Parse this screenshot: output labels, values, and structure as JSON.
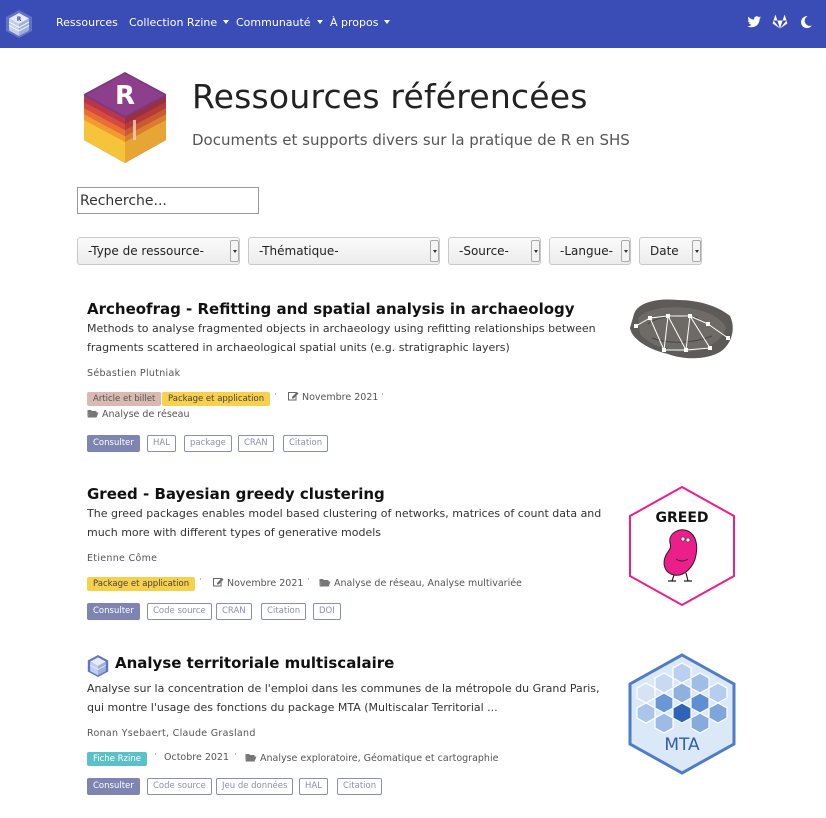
{
  "nav": {
    "items": [
      {
        "label": "Ressources",
        "dropdown": false
      },
      {
        "label": "Collection Rzine",
        "dropdown": true
      },
      {
        "label": "Communauté",
        "dropdown": true
      },
      {
        "label": "À propos",
        "dropdown": true
      }
    ],
    "icons": [
      "twitter-icon",
      "gitlab-icon",
      "dark-mode-moon-icon"
    ],
    "bar_color": "#3a4cb5"
  },
  "header": {
    "title": "Ressources référencées",
    "subtitle": "Documents et supports divers sur la pratique de R en SHS",
    "logo_letter": "R"
  },
  "search": {
    "placeholder": "Recherche...",
    "value": ""
  },
  "filters": [
    {
      "label": "-Type de ressource-"
    },
    {
      "label": "-Thématique-"
    },
    {
      "label": "-Source-"
    },
    {
      "label": "-Langue-"
    },
    {
      "label": "Date"
    }
  ],
  "entries": [
    {
      "title": "Archeofrag - Refitting and spatial analysis in archaeology",
      "description": "Methods to analyse fragmented objects in archaeology using refitting relationships between fragments scattered in archaeological spatial units (e.g. stratigraphic layers)",
      "authors": "Sébastien Plutniak",
      "badges": [
        "Article et billet",
        "Package et application"
      ],
      "date": "Novembre 2021",
      "topics": "Analyse de réseau",
      "buttons": [
        "Consulter",
        "HAL",
        "package",
        "CRAN",
        "Citation"
      ]
    },
    {
      "title": "Greed - Bayesian greedy clustering",
      "description": "The greed packages enables model based clustering of networks, matrices of count data and much more with different types of generative models",
      "authors": "Etienne Côme",
      "badges": [
        "Package et application"
      ],
      "date": "Novembre 2021",
      "topics": "Analyse de réseau, Analyse multivariée",
      "buttons": [
        "Consulter",
        "Code source",
        "CRAN",
        "Citation",
        "DOI"
      ],
      "logo_text": "GREED"
    },
    {
      "title": "Analyse territoriale multiscalaire",
      "description": "Analyse sur la concentration de l'emploi dans les communes de la métropole du Grand Paris, qui montre l'usage des fonctions du package MTA (Multiscalar Territorial ...",
      "authors": "Ronan Ysebaert, Claude Grasland",
      "badges": [
        "Fiche Rzine"
      ],
      "date": "Octobre 2021",
      "topics": "Analyse exploratoire, Géomatique et cartographie",
      "buttons": [
        "Consulter",
        "Code source",
        "Jeu de données",
        "HAL",
        "Citation"
      ],
      "logo_text": "MTA"
    }
  ]
}
